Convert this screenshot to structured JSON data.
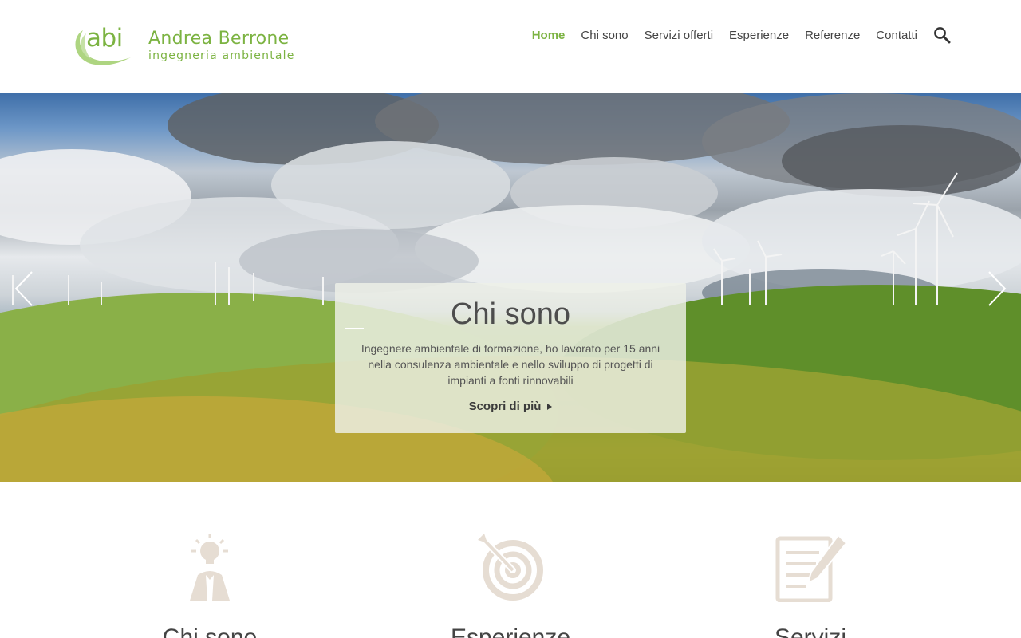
{
  "brand": {
    "logo_mark": "abi",
    "name": "Andrea Berrone",
    "tagline": "ingegneria ambientale",
    "accent_color": "#7cb342"
  },
  "nav": {
    "items": [
      {
        "label": "Home",
        "active": true
      },
      {
        "label": "Chi sono",
        "active": false
      },
      {
        "label": "Servizi offerti",
        "active": false
      },
      {
        "label": "Esperienze",
        "active": false
      },
      {
        "label": "Referenze",
        "active": false
      },
      {
        "label": "Contatti",
        "active": false
      }
    ],
    "search_icon": "search-icon"
  },
  "hero": {
    "prev_icon": "chevron-left-icon",
    "next_icon": "chevron-right-icon",
    "caption": {
      "title": "Chi sono",
      "text": "Ingegnere ambientale di formazione, ho lavorato per 15 anni nella consulenza ambientale e nello sviluppo di progetti di impianti a fonti rinnovabili",
      "link_label": "Scopri di più"
    }
  },
  "features": [
    {
      "icon": "lightbulb-person-icon",
      "title": "Chi sono"
    },
    {
      "icon": "target-icon",
      "title": "Esperienze"
    },
    {
      "icon": "document-pen-icon",
      "title": "Servizi"
    }
  ],
  "colors": {
    "icon_color": "#e6ddd3",
    "text_color": "#444444"
  }
}
